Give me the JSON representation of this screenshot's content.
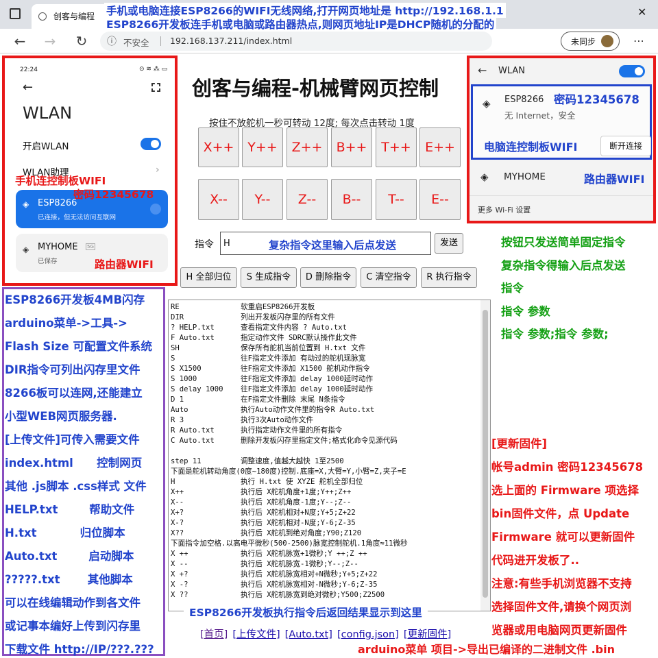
{
  "browser": {
    "tab_title": "创客与编程",
    "tab_close": "×",
    "min": "─",
    "max": "☐",
    "close": "✕",
    "insecure_label": "不安全",
    "url": "192.168.137.211/index.html",
    "profile_label": "未同步",
    "more": "⋯"
  },
  "banner": {
    "line1": "手机或电脑连接ESP8266的WIFI无线网络,打开网页地址是 http://192.168.1.1",
    "line2": "ESP8266开发板连手机或电脑或路由器热点,则网页地址IP是DHCP随机的分配的"
  },
  "page": {
    "title": "创客与编程-机械臂网页控制",
    "hint": "按住不放舵机一秒可转动 12度; 每次点击转动 1度",
    "plus_buttons": [
      "X++",
      "Y++",
      "Z++",
      "B++",
      "T++",
      "E++"
    ],
    "minus_buttons": [
      "X--",
      "Y--",
      "Z--",
      "B--",
      "T--",
      "E--"
    ],
    "cmd_label": "指令",
    "cmd_value": "H",
    "send_label": "发送",
    "cmd_overlay": "复杂指令这里输入后点发送",
    "action_buttons": [
      "H 全部归位",
      "S 生成指令",
      "D 删除指令",
      "C 清空指令",
      "R 执行指令"
    ],
    "output_lines": [
      "RE              软重启ESP8266开发板",
      "DIR             列出开发板闪存里的所有文件",
      "? HELP.txt      查看指定文件内容 ? Auto.txt",
      "F Auto.txt      指定动作文件 SDRC默认操作此文件",
      "SH              保存所有舵机当前位置到 H.txt 文件",
      "S               往F指定文件添加 有动过的舵机现脉宽",
      "S X1500         往F指定文件添加 X1500 舵机动作指令",
      "S 1000          往F指定文件添加 delay 1000延时动作",
      "S delay 1000    往F指定文件添加 delay 1000延时动作",
      "D 1             在F指定文件删除 末尾 N条指令",
      "Auto            执行Auto动作文件里的指令R Auto.txt",
      "R 3             执行3次Auto动作文件",
      "R Auto.txt      执行指定动作文件里的所有指令",
      "C Auto.txt      删除开发板闪存里指定文件;格式化命令见源代码",
      "",
      "step 11         调整速度,值越大越快 1至2500",
      "下面是舵机转动角度(0度~180度)控制.底座=X,大臂=Y,小臂=Z,夹子=E",
      "H               执行 H.txt 使 XYZE 舵机全部归位",
      "X++             执行后 X舵机角度+1度;Y++;Z++",
      "X--             执行后 X舵机角度-1度;Y--;Z--",
      "X+?             执行后 X舵机相对+N度;Y+5;Z+22",
      "X-?             执行后 X舵机相对-N度;Y-6;Z-35",
      "X??             执行后 X舵机到绝对角度;Y90;Z120",
      "下面指令加空格.以高电平微秒(500-2500)脉宽控制舵机.1角度≈11微秒",
      "X ++            执行后 X舵机脉宽+1微秒;Y ++;Z ++",
      "X --            执行后 X舵机脉宽-1微秒;Y--;Z--",
      "X +?            执行后 X舵机脉宽相对+N微秒;Y+5;Z+22",
      "X -?            执行后 X舵机脉宽相对-N微秒;Y-6;Z-35",
      "X ??            执行后 X舵机脉宽到绝对微秒;Y500;Z2500"
    ],
    "output_caption": "ESP8266开发板执行指令后返回结果显示到这里",
    "links": [
      "[首页]",
      "[上传文件]",
      "[Auto.txt]",
      "[config.json]",
      "[更新固件]"
    ]
  },
  "phone": {
    "time": "22:24",
    "status_icons": "⊙  ≋ ⁂ ▭",
    "title": "WLAN",
    "toggle_label": "开启WLAN",
    "assistant_label": "WLAN助理",
    "net1_name": "ESP8266",
    "net1_status": "已连接，但无法访问互联网",
    "net2_name": "MYHOME",
    "net2_badge": "5G",
    "net2_status": "已保存",
    "ann_wifi": "手机连控制板WIFI",
    "ann_pwd": "密码12345678",
    "ann_router": "路由器WIFI"
  },
  "win": {
    "title": "WLAN",
    "net1_name": "ESP8266",
    "net1_status": "无 Internet，安全",
    "disconnect": "断开连接",
    "net2_name": "MYHOME",
    "more": "更多 Wi-Fi 设置",
    "ann_pwd": "密码12345678",
    "ann_pc": "电脑连控制板WIFI",
    "ann_router": "路由器WIFI"
  },
  "left_notes": [
    "ESP8266开发板4MB闪存",
    "arduino菜单->工具->",
    "Flash Size 可配置文件系统",
    "DIR指令可列出闪存里文件",
    "8266板可以连网,还能建立",
    "小型WEB网页服务器.",
    "[上传文件]可传入需要文件",
    "index.html      控制网页",
    "其他 .js脚本 .css样式 文件",
    "HELP.txt        帮助文件",
    "H.txt           归位脚本",
    "Auto.txt        启动脚本",
    "?????.txt       其他脚本",
    "可以在线编辑动作到各文件",
    "或记事本编好上传到闪存里",
    "下载文件 http://IP/???.???"
  ],
  "right_notes_green": [
    "按钮只发送简单固定指令",
    "复杂指令得输入后点发送",
    "指令",
    "指令 参数",
    "指令 参数;指令 参数;"
  ],
  "right_notes_red": [
    "[更新固件]",
    "帐号admin 密码12345678",
    "选上面的 Firmware 项选择",
    "bin固件文件，点 Update",
    "Firmware 就可以更新固件",
    "代码进开发板了..",
    "注意:有些手机浏览器不支持",
    "选择固件文件,请换个网页浏",
    "览器或用电脑网页更新固件"
  ],
  "bottom_note": "arduino菜单 项目->导出已编译的二进制文件 .bin",
  "icons": {
    "back": "←",
    "forward": "→",
    "reload": "↻",
    "info": "ⓘ",
    "wifi": "◈",
    "lock": "🔒"
  },
  "colors": {
    "blue": "#2244cc",
    "red": "#e81818",
    "green": "#14a014",
    "purple": "#8a4fc0",
    "phone_accent": "#1a73e8"
  }
}
